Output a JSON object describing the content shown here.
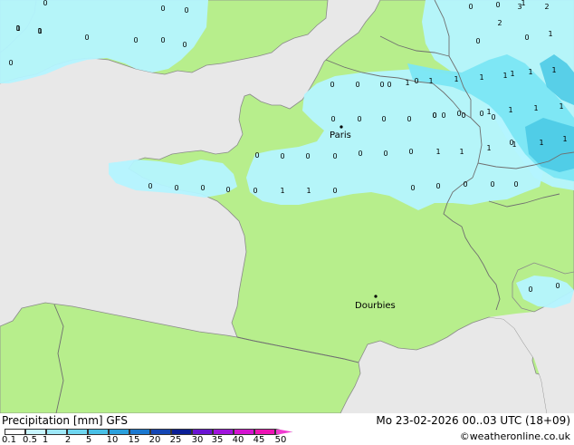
{
  "map": {
    "colors": {
      "sea": "#e8e8e8",
      "land": "#b7ee8c",
      "precip_light": "#b4f4ff",
      "precip_mid": "#7be6f4",
      "precip_heavy": "#4ecbe6",
      "border": "#6f6f6f",
      "coast": "#8a8a8a"
    },
    "cities": [
      {
        "name": "Paris"
      },
      {
        "name": "Dourbies"
      }
    ],
    "precip_values": [
      "0",
      "0",
      "0",
      "0",
      "0",
      "0",
      "0",
      "0",
      "0",
      "0",
      "0",
      "0",
      "0",
      "0",
      "0",
      "0",
      "0",
      "0",
      "0",
      "0",
      "0",
      "0",
      "0",
      "0",
      "0",
      "0",
      "0",
      "0",
      "0",
      "0",
      "0",
      "0",
      "0",
      "0",
      "0",
      "0",
      "0",
      "0",
      "0",
      "0",
      "0",
      "0",
      "0",
      "0",
      "0",
      "0",
      "0",
      "0",
      "0",
      "0",
      "0",
      "1",
      "1",
      "1",
      "1",
      "1",
      "1",
      "1",
      "1",
      "1",
      "1",
      "1",
      "1",
      "1",
      "1",
      "1",
      "1",
      "1",
      "1",
      "1",
      "1",
      "1",
      "2",
      "3",
      "2",
      "1",
      "1",
      "1"
    ]
  },
  "footer": {
    "title": "Precipitation [mm] GFS",
    "datetime": "Mo 23-02-2026 00..03 UTC (18+09)",
    "copyright": "©weatheronline.co.uk",
    "legend_labels": [
      "0.1",
      "0.5",
      "1",
      "2",
      "5",
      "10",
      "15",
      "20",
      "25",
      "30",
      "35",
      "40",
      "45",
      "50"
    ],
    "legend_colors": [
      "#ffffff",
      "#c8f5ff",
      "#9ee8f8",
      "#6fd6f0",
      "#48c0e6",
      "#2aa0dc",
      "#1a78d0",
      "#1446b4",
      "#0a1e96",
      "#6a14d2",
      "#a014dc",
      "#d414d0",
      "#ee14b4",
      "#f03cd0"
    ]
  }
}
